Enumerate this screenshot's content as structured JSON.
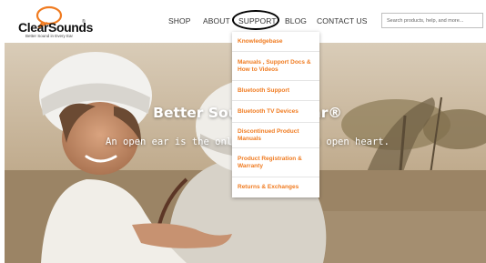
{
  "brand": {
    "name": "ClearSounds",
    "trademark": "®",
    "tagline": "Better Sound in Every Ear"
  },
  "nav": {
    "items": [
      "SHOP",
      "ABOUT",
      "SUPPORT",
      "BLOG",
      "CONTACT US"
    ],
    "active": "SUPPORT"
  },
  "search": {
    "placeholder": "Search products, help, and more...",
    "value": ""
  },
  "dropdown": {
    "items": [
      "Knowledgebase",
      "Manuals , Support Docs & How to Videos",
      "Bluetooth Support",
      "Bluetooth TV Devices",
      "Discontinued Product Manuals",
      "Product Registration & Warranty",
      "Returns & Exchanges"
    ]
  },
  "hero": {
    "title_visible": "Better Sou",
    "title_visible_end": "Ear®",
    "subtitle_visible": "An open ear is the only",
    "subtitle_visible_end": "an open heart."
  },
  "colors": {
    "accent": "#f07b20",
    "nav_text": "#333333",
    "header_bg": "#ffffff"
  }
}
